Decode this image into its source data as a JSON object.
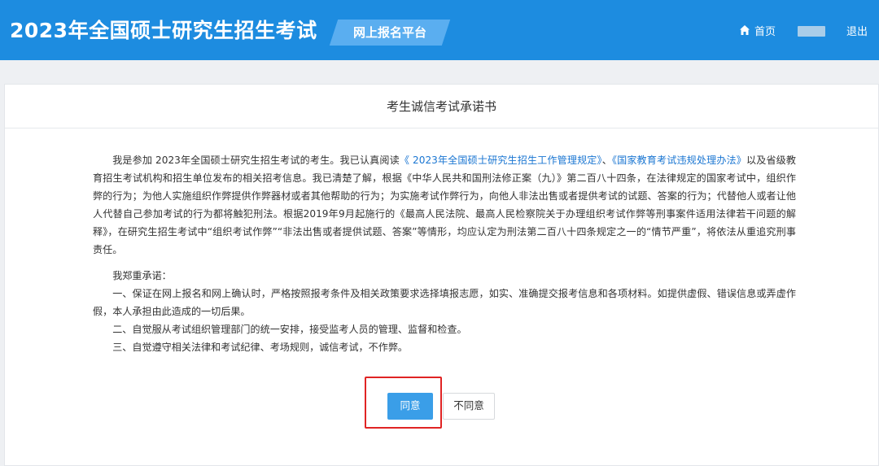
{
  "header": {
    "site_title": "2023年全国硕士研究生招生考试",
    "platform_label": "网上报名平台",
    "home_label": "首页",
    "logout_label": "退出"
  },
  "card": {
    "title": "考生诚信考试承诺书",
    "paragraph1": {
      "text_a": "我是参加 2023年全国硕士研究生招生考试的考生。我已认真阅读",
      "link1": "《 2023年全国硕士研究生招生工作管理规定》",
      "sep": "、",
      "link2": "《国家教育考试违规处理办法》",
      "text_b": "以及省级教育招生考试机构和招生单位发布的相关招考信息。我已清楚了解，根据《中华人民共和国刑法修正案（九）》第二百八十四条，在法律规定的国家考试中，组织作弊的行为；为他人实施组织作弊提供作弊器材或者其他帮助的行为；为实施考试作弊行为，向他人非法出售或者提供考试的试题、答案的行为；代替他人或者让他人代替自己参加考试的行为都将触犯刑法。根据2019年9月起施行的《最高人民法院、最高人民检察院关于办理组织考试作弊等刑事案件适用法律若干问题的解释》，在研究生招生考试中“组织考试作弊”“非法出售或者提供试题、答案”等情形，均应认定为刑法第二百八十四条规定之一的“情节严重”，将依法从重追究刑事责任。"
    },
    "pledge_intro": "我郑重承诺：",
    "pledges": [
      "一、保证在网上报名和网上确认时，严格按照报考条件及相关政策要求选择填报志愿，如实、准确提交报考信息和各项材料。如提供虚假、错误信息或弄虚作假，本人承担由此造成的一切后果。",
      "二、自觉服从考试组织管理部门的统一安排，接受监考人员的管理、监督和检查。",
      "三、自觉遵守相关法律和考试纪律、考场规则，诚信考试，不作弊。"
    ],
    "agree_label": "同意",
    "disagree_label": "不同意"
  },
  "colors": {
    "header_bg": "#1d8ce0",
    "badge_bg": "#5aaef0",
    "link": "#1a76d2",
    "agree_bg": "#3a9ee8",
    "highlight": "#e02424"
  },
  "icons": {
    "home": "home-icon"
  }
}
